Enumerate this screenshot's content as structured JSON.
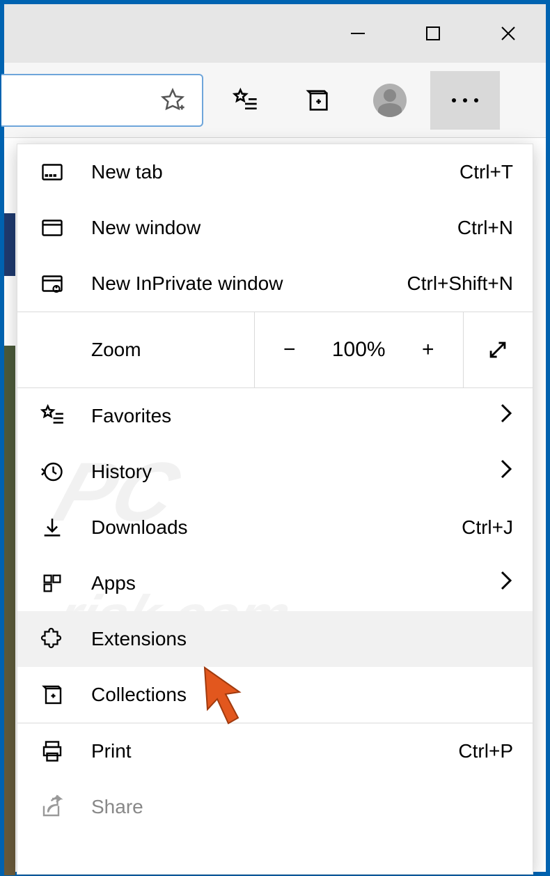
{
  "titlebar": {
    "minimize_tooltip": "Minimize",
    "maximize_tooltip": "Maximize",
    "close_tooltip": "Close"
  },
  "toolbar": {
    "add_favorite_tooltip": "Add this page to favorites",
    "favorites_tooltip": "Favorites",
    "collections_tooltip": "Collections",
    "profile_tooltip": "Profile",
    "more_tooltip": "Settings and more"
  },
  "menu": {
    "items": [
      {
        "label": "New tab",
        "shortcut": "Ctrl+T",
        "icon": "new-tab-icon"
      },
      {
        "label": "New window",
        "shortcut": "Ctrl+N",
        "icon": "window-icon"
      },
      {
        "label": "New InPrivate window",
        "shortcut": "Ctrl+Shift+N",
        "icon": "inprivate-icon"
      }
    ],
    "zoom": {
      "label": "Zoom",
      "level": "100%",
      "minus": "−",
      "plus": "+",
      "full": "⤢"
    },
    "items2": [
      {
        "label": "Favorites",
        "icon": "favorites-icon",
        "chevron": true
      },
      {
        "label": "History",
        "icon": "history-icon",
        "chevron": true
      },
      {
        "label": "Downloads",
        "shortcut": "Ctrl+J",
        "icon": "download-icon"
      },
      {
        "label": "Apps",
        "icon": "apps-icon",
        "chevron": true
      },
      {
        "label": "Extensions",
        "icon": "extensions-icon",
        "highlight": true
      },
      {
        "label": "Collections",
        "icon": "collections-icon"
      }
    ],
    "items3": [
      {
        "label": "Print",
        "shortcut": "Ctrl+P",
        "icon": "print-icon"
      },
      {
        "label": "Share",
        "icon": "share-icon",
        "disabled": true
      }
    ]
  },
  "watermark": {
    "line1": "PC",
    "line2": "risk.com"
  }
}
